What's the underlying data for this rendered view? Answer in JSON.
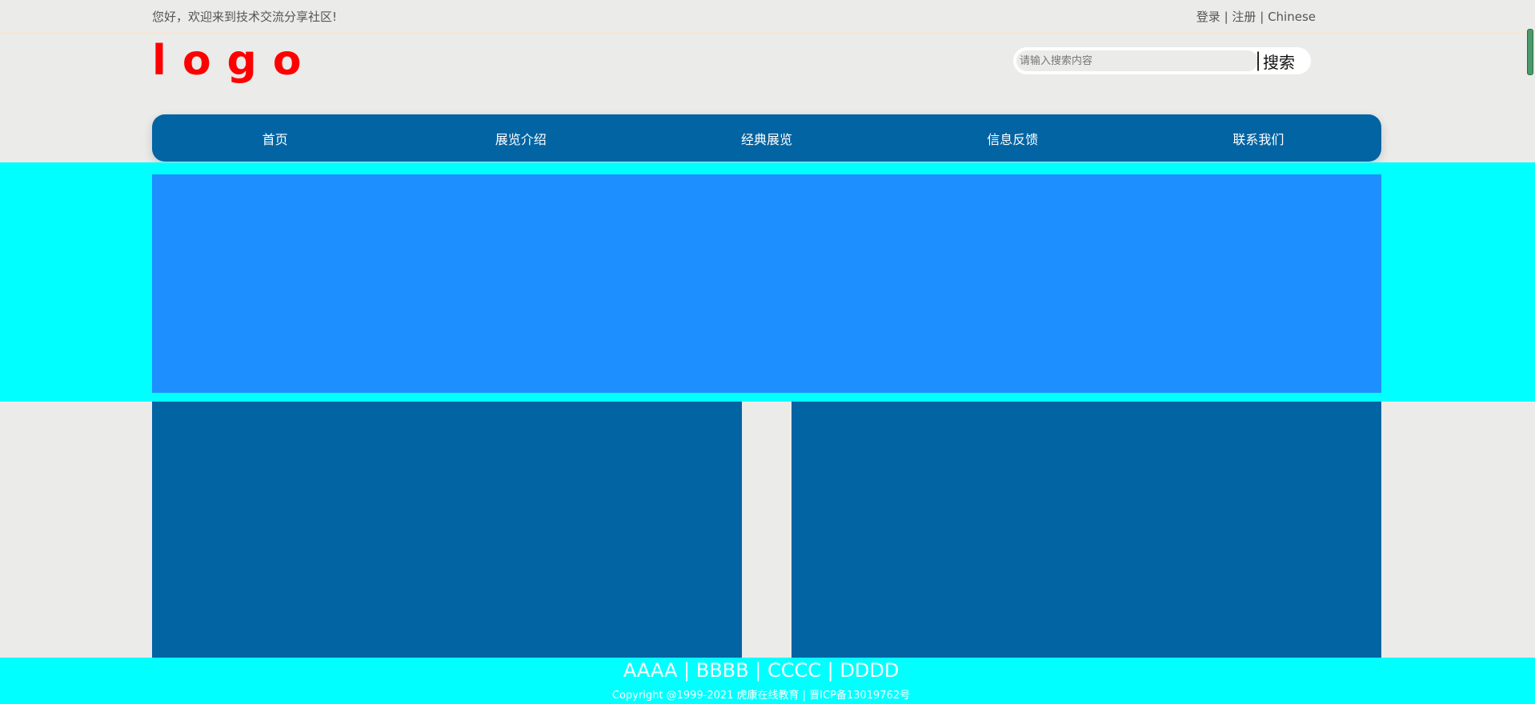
{
  "topbar": {
    "welcome": "您好，欢迎来到技术交流分享社区!",
    "login": "登录",
    "register": "注册",
    "language": "Chinese",
    "separator": "|"
  },
  "header": {
    "logo": "logo",
    "search_placeholder": "请输入搜索内容",
    "search_separator": "|",
    "search_button": "搜索"
  },
  "nav": {
    "items": [
      "首页",
      "展览介绍",
      "经典展览",
      "信息反馈",
      "联系我们"
    ]
  },
  "footer": {
    "links": [
      "AAAA",
      "BBBB",
      "CCCC",
      "DDDD"
    ],
    "separator": "|",
    "copyright": "Copyright @1999-2021 虎康在线教育 | 晋ICP备13019762号"
  },
  "colors": {
    "nav_bg": "#0264a3",
    "banner_band": "#00ffff",
    "banner": "#1e8fff",
    "logo": "#ff0000",
    "page_bg": "#ebebe9"
  }
}
